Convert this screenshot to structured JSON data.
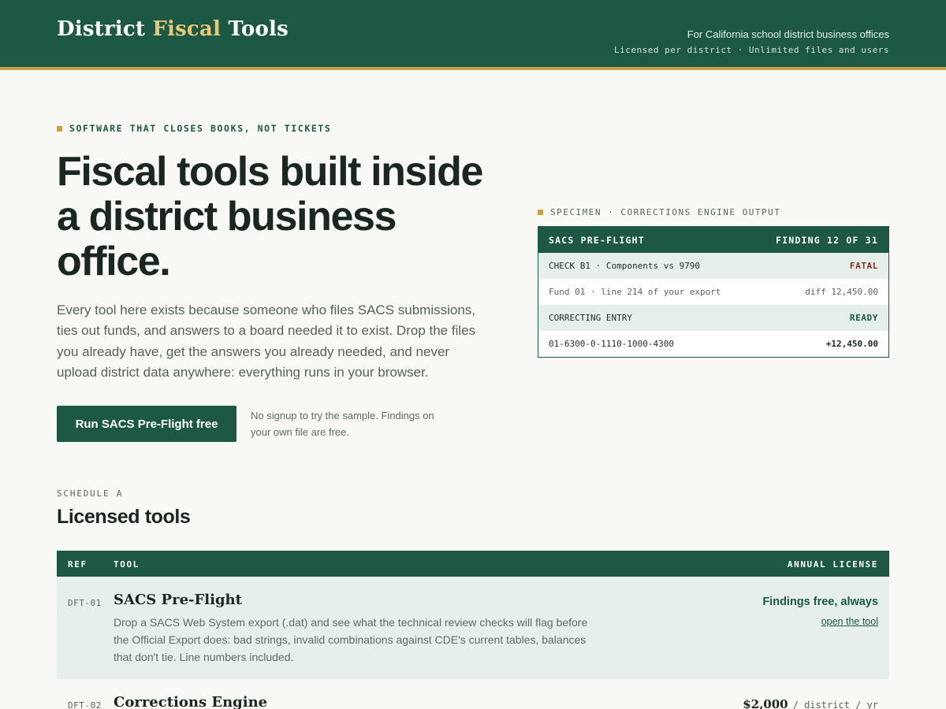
{
  "header": {
    "brand_part1": "District",
    "brand_accent": "Fiscal",
    "brand_part2": "Tools",
    "tagline": "For California school district business offices",
    "licensing": "Licensed per district · Unlimited files and users"
  },
  "hero": {
    "eyebrow": "SOFTWARE THAT CLOSES BOOKS, NOT TICKETS",
    "title": "Fiscal tools built inside a district business office.",
    "body": "Every tool here exists because someone who files SACS submissions, ties out funds, and answers to a board needed it to exist. Drop the files you already have, get the answers you already needed, and never upload district data anywhere: everything runs in your browser.",
    "cta_label": "Run SACS Pre-Flight free",
    "cta_note": "No signup to try the sample. Findings on your own file are free."
  },
  "specimen": {
    "label": "SPECIMEN · CORRECTIONS ENGINE OUTPUT",
    "header_left": "SACS PRE-FLIGHT",
    "header_right": "FINDING 12 OF 31",
    "check_label": "CHECK B1 · Components vs 9790",
    "check_status": "FATAL",
    "location": "Fund 01 · line 214 of your export",
    "diff": "diff 12,450.00",
    "entry_label": "CORRECTING ENTRY",
    "entry_status": "READY",
    "account": "01-6300-0-1110-1000-4300",
    "amount": "+12,450.00"
  },
  "schedule": {
    "label": "SCHEDULE A",
    "title": "Licensed tools",
    "columns": {
      "ref": "REF",
      "tool": "TOOL",
      "license": "ANNUAL LICENSE"
    },
    "rows": [
      {
        "ref": "DFT-01",
        "name": "SACS Pre-Flight",
        "description": "Drop a SACS Web System export (.dat) and see what the technical review checks will flag before the Official Export does: bad strings, invalid combinations against CDE's current tables, balances that don't tie. Line numbers included.",
        "license": "Findings free, always",
        "link": "open the tool"
      },
      {
        "ref": "DFT-02",
        "name": "Corrections Engine",
        "price": "$2,000",
        "per": "/ district / yr"
      }
    ]
  },
  "colors": {
    "primary": "#1c5843",
    "gold": "#c7a24a",
    "background": "#f8f9f4",
    "fatal": "#8a2a1c"
  }
}
